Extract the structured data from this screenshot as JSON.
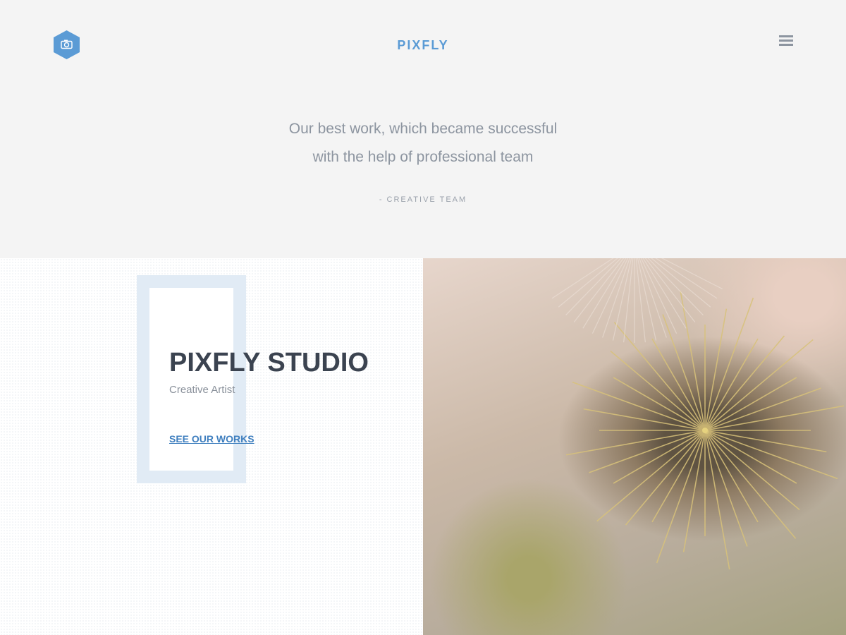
{
  "header": {
    "logo_icon": "camera-hexagon-icon",
    "brand": "PIXFLY",
    "menu_icon": "hamburger-menu-icon",
    "accent_color": "#5b9bd5"
  },
  "hero": {
    "quote_line_1": "Our best work, which became successful",
    "quote_line_2": "with the help of professional team",
    "author": "- CREATIVE TEAM"
  },
  "studio": {
    "title": "PIXFLY STUDIO",
    "subtitle": "Creative Artist",
    "link_label": "SEE OUR WORKS",
    "frame_color": "#e1ebf5"
  },
  "photo": {
    "subject": "dandelion-closeup-image"
  }
}
